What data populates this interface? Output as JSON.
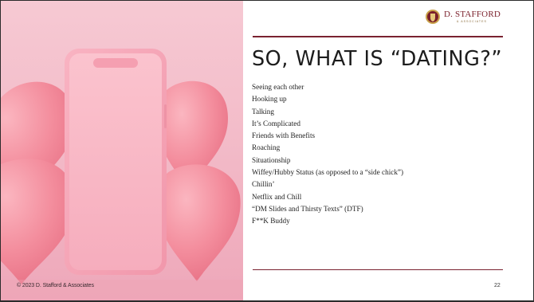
{
  "slide": {
    "title": "SO, WHAT IS “DATING?”",
    "items": [
      "Seeing each other",
      "Hooking up",
      "Talking",
      "It’s Complicated",
      "Friends with Benefits",
      "Roaching",
      "Situationship",
      "Wiffey/Hubby Status (as opposed to a “side chick”)",
      "Chillin’",
      "Netflix and Chill",
      "“DM Slides and Thirsty Texts” (DTF)",
      "F**K Buddy"
    ],
    "footer": "© 2023 D. Stafford & Associates",
    "page_number": "22"
  },
  "logo": {
    "name": "D. STAFFORD",
    "subtitle": "& ASSOCIATES",
    "icon": "shield-crest-icon"
  },
  "image": {
    "icons": [
      "smartphone-icon",
      "heart-icon"
    ]
  },
  "colors": {
    "accent_rule": "#7a2230",
    "background_pink": "#f3bcc9",
    "heart": "#f58f9e",
    "phone_body": "#f5a3b3"
  }
}
